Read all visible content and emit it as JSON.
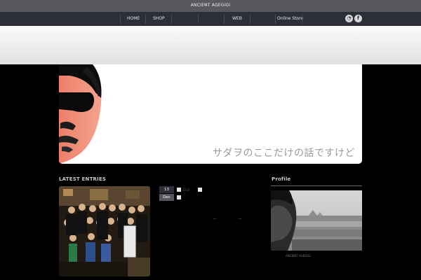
{
  "site": {
    "title": "ANCIENT AGEGiGi"
  },
  "nav": {
    "items": [
      {
        "label": "HOME"
      },
      {
        "label": "SHOP"
      },
      {
        "label": "WEB"
      },
      {
        "label": "Online Store"
      }
    ],
    "social": [
      {
        "icon": "rss-icon",
        "glyph": "◔"
      },
      {
        "icon": "facebook-icon",
        "glyph": "f"
      }
    ]
  },
  "header": {
    "tagline": "サダヲのここだけの話ですけど"
  },
  "latest": {
    "title": "LATEST ENTRIES"
  },
  "entry": {
    "day": "13",
    "month": "Dec",
    "year": "2016"
  },
  "profile": {
    "title": "Profile",
    "name": "ANCIENT AGEGiGi"
  },
  "colors": {
    "nav_bg": "#2c2f38",
    "topbar_bg": "#58595c",
    "page_bg": "#000000",
    "tagline": "#9a9a9a"
  }
}
